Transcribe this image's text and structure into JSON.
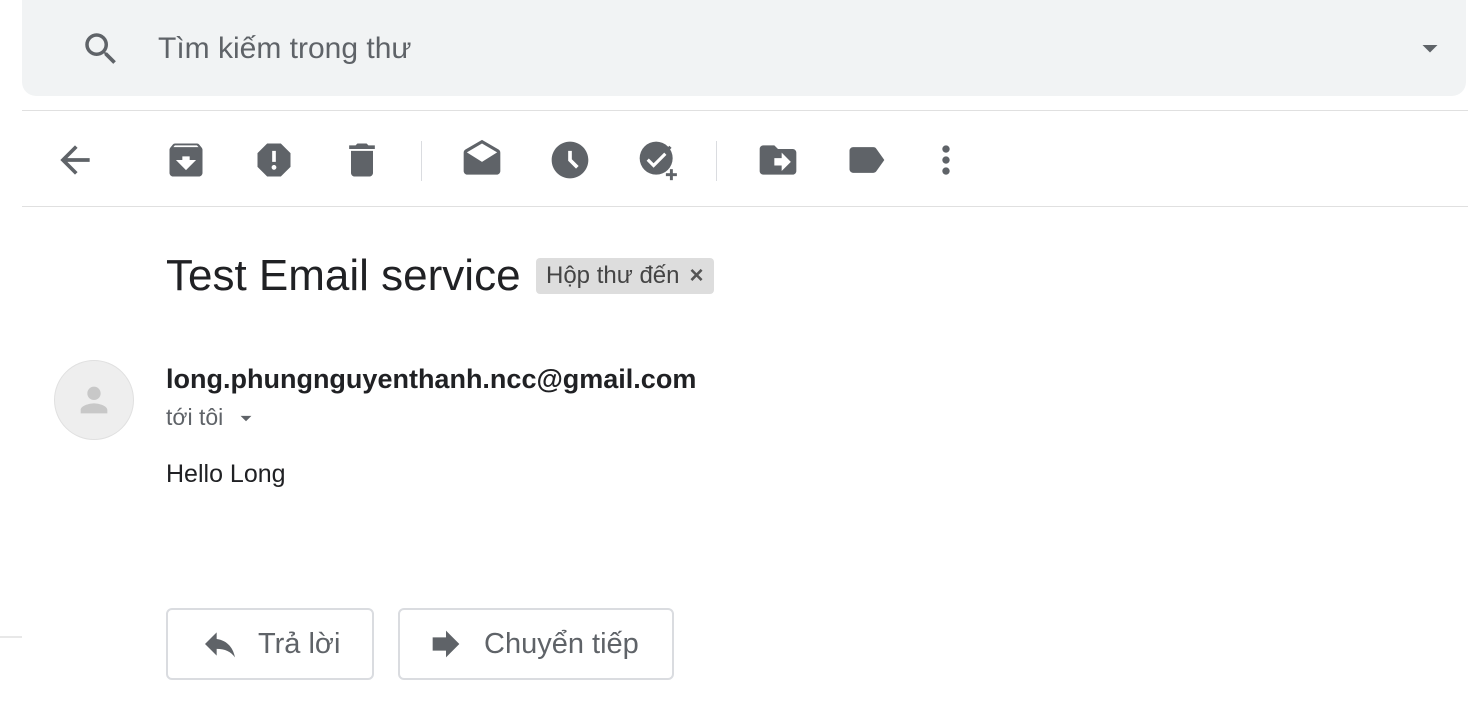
{
  "search": {
    "placeholder": "Tìm kiếm trong thư",
    "icon": "search-icon",
    "options_icon": "arrow-drop-down-icon"
  },
  "toolbar": {
    "icons": [
      "back-arrow-icon",
      "archive-icon",
      "report-spam-icon",
      "delete-icon",
      "mark-unread-icon",
      "snooze-icon",
      "add-to-tasks-icon",
      "move-to-icon",
      "label-icon",
      "more-vert-icon"
    ]
  },
  "email": {
    "subject": "Test Email service",
    "label_chip": "Hộp thư đến",
    "label_close": "×",
    "sender": "long.phungnguyenthanh.ncc@gmail.com",
    "recipient": "tới tôi",
    "body": "Hello Long"
  },
  "actions": {
    "reply_label": "Trả lời",
    "forward_label": "Chuyển tiếp"
  },
  "colors": {
    "icon_gray": "#5f6368",
    "search_bg": "#f1f3f4"
  }
}
